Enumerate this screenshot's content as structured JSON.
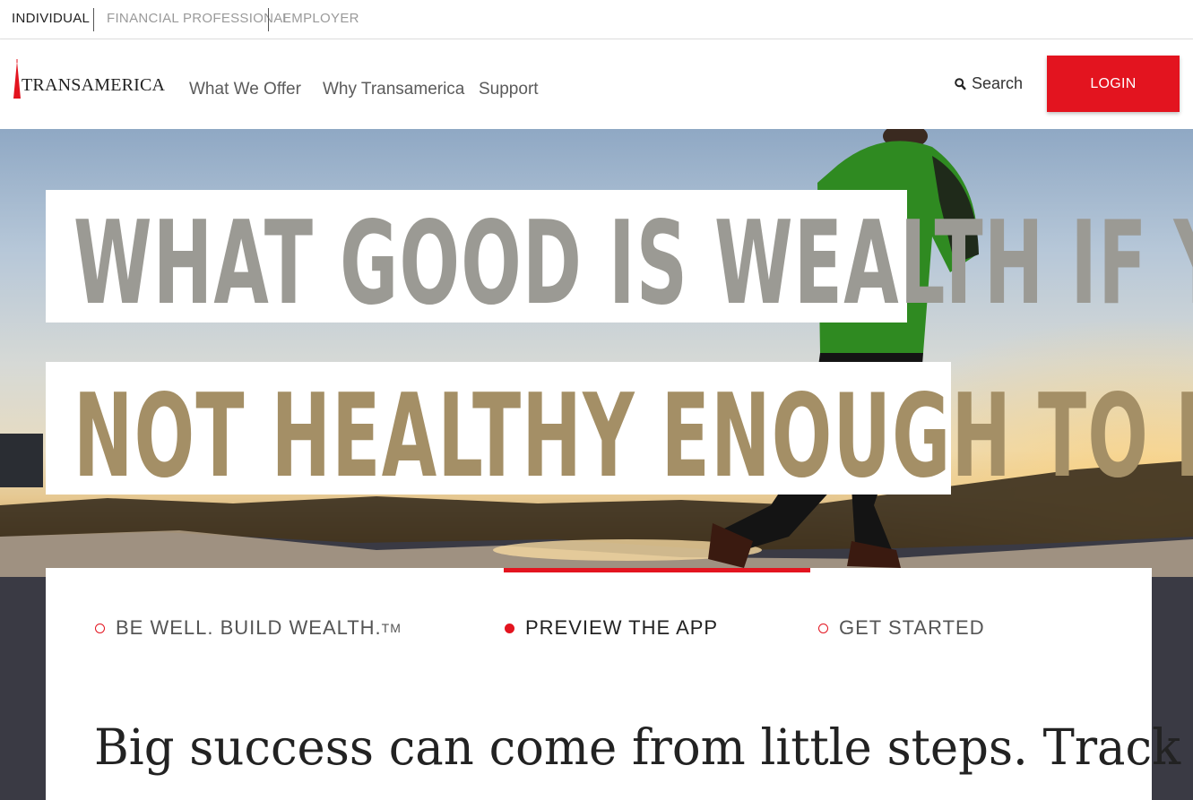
{
  "audience": {
    "tabs": [
      {
        "label": "INDIVIDUAL",
        "active": true
      },
      {
        "label": "FINANCIAL PROFESSIONAL",
        "active": false
      },
      {
        "label": "EMPLOYER",
        "active": false
      }
    ]
  },
  "header": {
    "logo_text": "TRANSAMERICA",
    "nav": [
      {
        "label": "What We Offer"
      },
      {
        "label": "Why Transamerica"
      },
      {
        "label": "Support"
      }
    ],
    "search_label": "Search",
    "login_label": "LOGIN"
  },
  "hero": {
    "headline_line1": "WHAT GOOD IS WEALTH IF YOU’RE",
    "headline_line2": "NOT HEALTHY ENOUGH TO ENJOY IT?"
  },
  "card": {
    "steps": [
      {
        "label": "BE WELL. BUILD WEALTH.",
        "suffix": "TM",
        "active": false
      },
      {
        "label": "PREVIEW THE APP",
        "active": true
      },
      {
        "label": "GET STARTED",
        "active": false
      }
    ],
    "tagline": "Big success can come from little steps. Track your"
  },
  "colors": {
    "brand_red": "#e3141f",
    "text_dark": "#222222",
    "nav_gray": "#5b5b5b"
  },
  "icons": {
    "search": "search-icon",
    "logo": "pyramid-logo-icon",
    "step_dot": "circle-dot-icon"
  }
}
